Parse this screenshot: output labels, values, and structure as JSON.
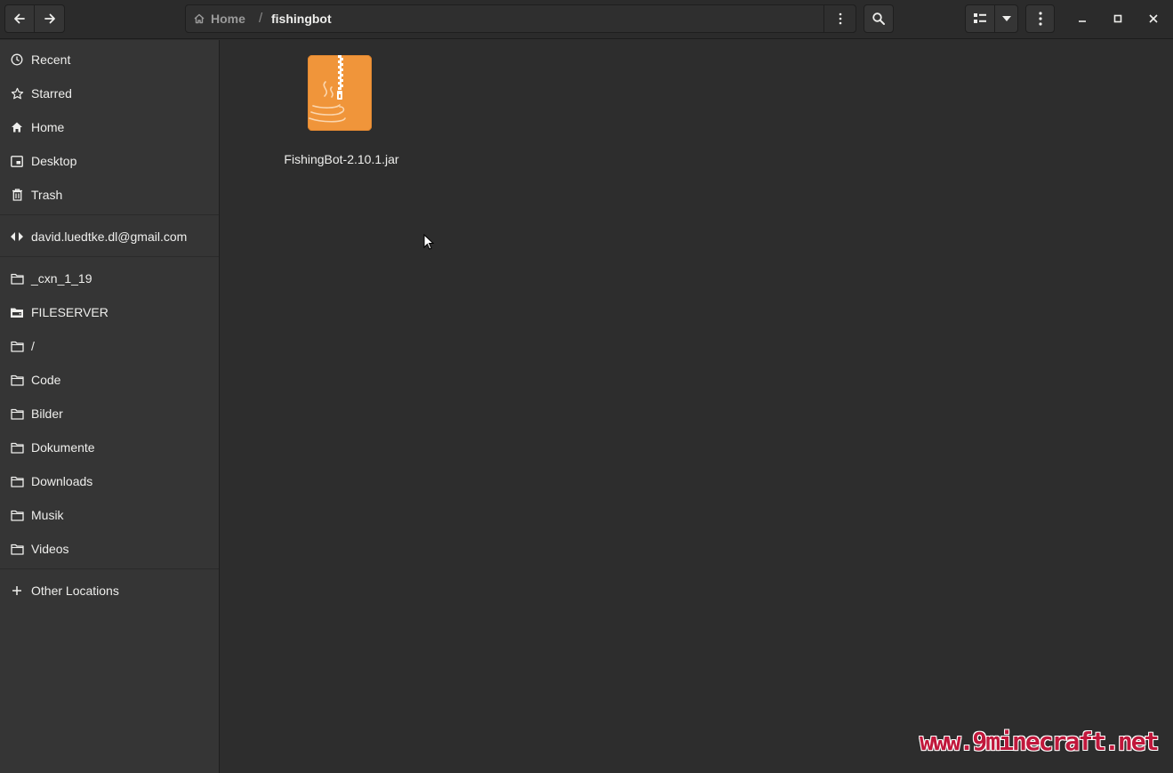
{
  "header": {
    "breadcrumb": {
      "home_label": "Home",
      "separator": "/",
      "current_label": "fishingbot"
    }
  },
  "sidebar": {
    "places": [
      {
        "label": "Recent",
        "icon": "clock-icon"
      },
      {
        "label": "Starred",
        "icon": "star-icon"
      },
      {
        "label": "Home",
        "icon": "home-icon"
      },
      {
        "label": "Desktop",
        "icon": "desktop-icon"
      },
      {
        "label": "Trash",
        "icon": "trash-icon"
      }
    ],
    "account": {
      "label": "david.luedtke.dl@gmail.com",
      "icon": "network-account-icon"
    },
    "bookmarks": [
      {
        "label": "_cxn_1_19",
        "icon": "folder-icon"
      },
      {
        "label": "FILESERVER",
        "icon": "network-drive-icon"
      },
      {
        "label": "/",
        "icon": "folder-icon"
      },
      {
        "label": "Code",
        "icon": "folder-icon"
      },
      {
        "label": "Bilder",
        "icon": "folder-icon"
      },
      {
        "label": "Dokumente",
        "icon": "folder-icon"
      },
      {
        "label": "Downloads",
        "icon": "folder-icon"
      },
      {
        "label": "Musik",
        "icon": "folder-icon"
      },
      {
        "label": "Videos",
        "icon": "folder-icon"
      }
    ],
    "other_locations": {
      "label": "Other Locations",
      "icon": "plus-icon"
    }
  },
  "main": {
    "files": [
      {
        "name": "FishingBot-2.10.1.jar",
        "icon": "java-archive-icon"
      }
    ]
  },
  "watermark": "www.9minecraft.net",
  "colors": {
    "background": "#2d2d2d",
    "sidebar": "#353535",
    "archive_orange": "#f0953a"
  }
}
